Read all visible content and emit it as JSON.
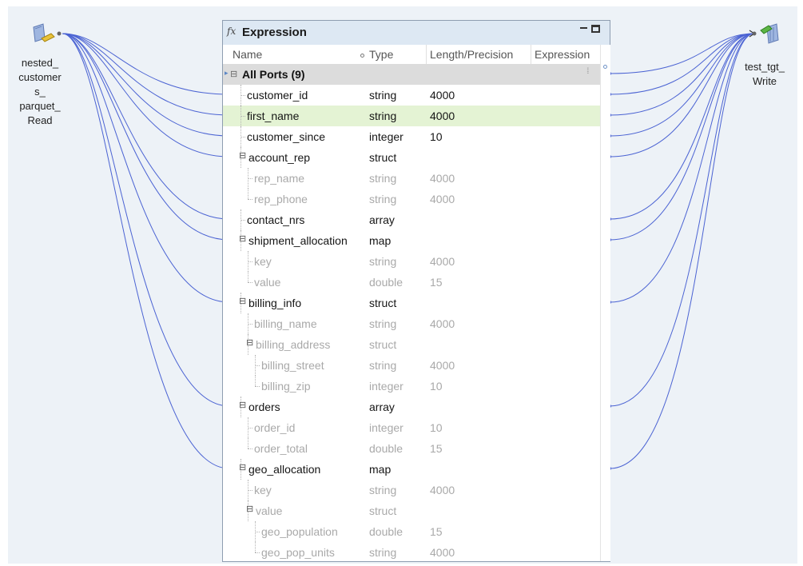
{
  "source_node": {
    "label": "nested_\ncustomer\ns_\nparquet_\nRead",
    "icon": "parquet-source-icon"
  },
  "target_node": {
    "label": "test_tgt_\nWrite",
    "icon": "target-write-icon"
  },
  "expression": {
    "fx_icon": "fx",
    "title": "Expression",
    "columns": {
      "name": "Name",
      "type": "Type",
      "length": "Length/Precision",
      "expression": "Expression"
    },
    "all_ports": "All Ports (9)",
    "ports": [
      {
        "name": "customer_id",
        "type": "string",
        "length": "4000",
        "level": 0,
        "active": true
      },
      {
        "name": "first_name",
        "type": "string",
        "length": "4000",
        "level": 0,
        "active": true,
        "selected": true
      },
      {
        "name": "customer_since",
        "type": "integer",
        "length": "10",
        "level": 0,
        "active": true
      },
      {
        "name": "account_rep",
        "type": "struct",
        "length": "",
        "level": 0,
        "active": true,
        "expandable": true
      },
      {
        "name": "rep_name",
        "type": "string",
        "length": "4000",
        "level": 1,
        "active": false
      },
      {
        "name": "rep_phone",
        "type": "string",
        "length": "4000",
        "level": 1,
        "active": false
      },
      {
        "name": "contact_nrs",
        "type": "array",
        "length": "",
        "level": 0,
        "active": true
      },
      {
        "name": "shipment_allocation",
        "type": "map",
        "length": "",
        "level": 0,
        "active": true,
        "expandable": true
      },
      {
        "name": "key",
        "type": "string",
        "length": "4000",
        "level": 1,
        "active": false
      },
      {
        "name": "value",
        "type": "double",
        "length": "15",
        "level": 1,
        "active": false
      },
      {
        "name": "billing_info",
        "type": "struct",
        "length": "",
        "level": 0,
        "active": true,
        "expandable": true
      },
      {
        "name": "billing_name",
        "type": "string",
        "length": "4000",
        "level": 1,
        "active": false
      },
      {
        "name": "billing_address",
        "type": "struct",
        "length": "",
        "level": 1,
        "active": false,
        "expandable": true
      },
      {
        "name": "billing_street",
        "type": "string",
        "length": "4000",
        "level": 2,
        "active": false
      },
      {
        "name": "billing_zip",
        "type": "integer",
        "length": "10",
        "level": 2,
        "active": false
      },
      {
        "name": "orders",
        "type": "array",
        "length": "",
        "level": 0,
        "active": true,
        "expandable": true
      },
      {
        "name": "order_id",
        "type": "integer",
        "length": "10",
        "level": 1,
        "active": false
      },
      {
        "name": "order_total",
        "type": "double",
        "length": "15",
        "level": 1,
        "active": false
      },
      {
        "name": "geo_allocation",
        "type": "map",
        "length": "",
        "level": 0,
        "active": true,
        "expandable": true
      },
      {
        "name": "key",
        "type": "string",
        "length": "4000",
        "level": 1,
        "active": false
      },
      {
        "name": "value",
        "type": "struct",
        "length": "",
        "level": 1,
        "active": false,
        "expandable": true
      },
      {
        "name": "geo_population",
        "type": "double",
        "length": "15",
        "level": 2,
        "active": false
      },
      {
        "name": "geo_pop_units",
        "type": "string",
        "length": "4000",
        "level": 2,
        "active": false
      }
    ]
  },
  "colors": {
    "link": "#4b63d3",
    "canvas": "#edf2f7",
    "selected_row": "#e4f3d4",
    "header": "#dde8f3"
  }
}
